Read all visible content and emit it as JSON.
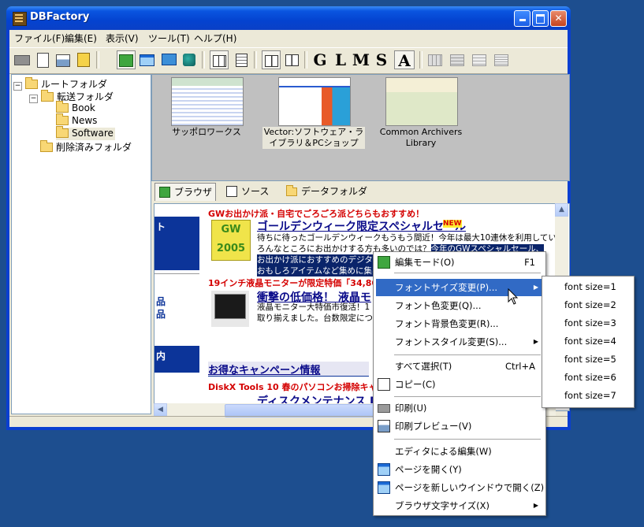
{
  "window": {
    "title": "DBFactory"
  },
  "menubar": [
    "ファイル(F)",
    "編集(E)",
    "表示(V)",
    "ツール(T)",
    "ヘルプ(H)"
  ],
  "toolbar": {
    "letters": [
      "G",
      "L",
      "M",
      "S",
      "A"
    ]
  },
  "tree": {
    "root": "ルートフォルダ",
    "inbox": "転送フォルダ",
    "children": [
      "Book",
      "News",
      "Software"
    ],
    "trash": "削除済みフォルダ"
  },
  "thumbnails": [
    {
      "label": "サッポロワークス"
    },
    {
      "label": "Vector:ソフトウェア・ライブラリ＆PCショップ"
    },
    {
      "label": "Common Archivers Library"
    }
  ],
  "tabs": [
    "ブラウザ",
    "ソース",
    "データフォルダ"
  ],
  "browser": {
    "banner": "GWお出かけ派・自宅でごろごろ派どちらもおすすめ！",
    "headline1": "ゴールデンウィーク限定スペシャルセール",
    "new_badge": "NEW",
    "gw_badge": "GW 2005",
    "body1a": "待ちに待ったゴールデンウィークもうもう間近！今年は最大10連休を利用してい",
    "body1b": "ろんなところにお出かけする方も多いのでは？",
    "body1c": "今年のGWスペシャルセール、",
    "body1d": "お出かけ派におすすめのデジタルグッズから、自宅でごろごろ派におすすめの",
    "body1e": "おもしろアイテムなど集めに集め",
    "side1": "ト",
    "side2": "品",
    "side3": "品",
    "side4": "内",
    "banner2": "19インチ液晶モニターが限定特価「34,80",
    "headline2": "衝撃の低価格！ 液晶モ",
    "body2a": "液晶モニター大特価市復活！1",
    "body2b": "取り揃えました。台数限定につき",
    "headline3": "お得なキャンペーン情報",
    "banner3": "DiskX Tools 10 春のパソコンお掃除キャ",
    "headline4": "ディスクメンテナンス DiskX Tools"
  },
  "context_menu": {
    "items": [
      {
        "label": "編集モード(O)",
        "shortcut": "F1"
      },
      {
        "label": "フォントサイズ変更(P)..."
      },
      {
        "label": "フォント色変更(Q)..."
      },
      {
        "label": "フォント背景色変更(R)..."
      },
      {
        "label": "フォントスタイル変更(S)..."
      },
      {
        "label": "すべて選択(T)",
        "shortcut": "Ctrl+A"
      },
      {
        "label": "コピー(C)"
      },
      {
        "label": "印刷(U)"
      },
      {
        "label": "印刷プレビュー(V)"
      },
      {
        "label": "エディタによる編集(W)"
      },
      {
        "label": "ページを開く(Y)"
      },
      {
        "label": "ページを新しいウインドウで開く(Z)"
      },
      {
        "label": "ブラウザ文字サイズ(X)"
      }
    ]
  },
  "submenu": [
    "font size=1",
    "font size=2",
    "font size=3",
    "font size=4",
    "font size=5",
    "font size=6",
    "font size=7"
  ],
  "colors": {
    "titlebar": "#0443d0",
    "menu_highlight": "#316ac5",
    "desktop": "#1d4e8f"
  }
}
